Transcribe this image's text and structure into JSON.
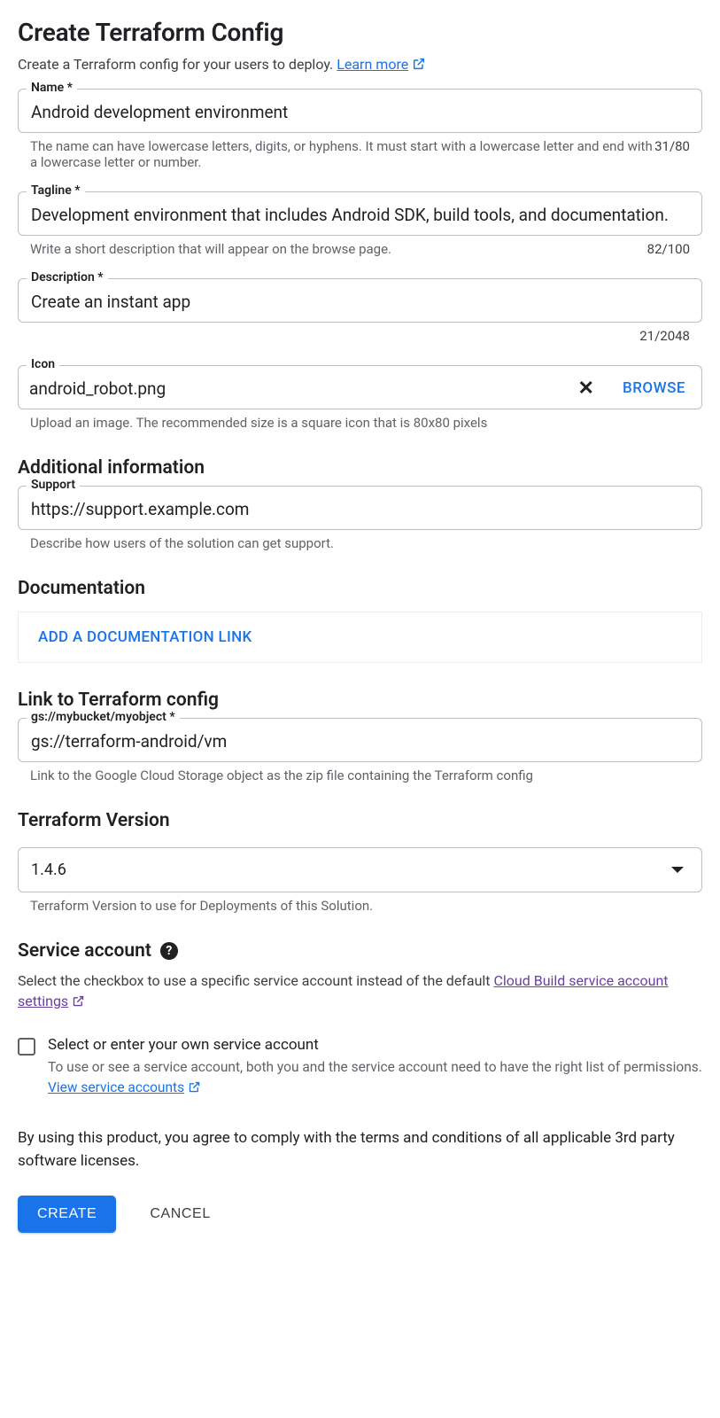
{
  "title": "Create Terraform Config",
  "subtitle_pre": "Create a Terraform config for your users to deploy. ",
  "subtitle_link": "Learn more",
  "fields": {
    "name": {
      "label": "Name *",
      "value": "Android development environment",
      "helper": "The name can have lowercase letters, digits, or hyphens. It must start with a lowercase letter and end with a lowercase letter or number.",
      "counter": "31/80"
    },
    "tagline": {
      "label": "Tagline *",
      "value": "Development environment that includes Android SDK, build tools, and documentation.",
      "helper": "Write a short description that will appear on the browse page.",
      "counter": "82/100"
    },
    "description": {
      "label": "Description *",
      "value": "Create an instant app",
      "counter": "21/2048"
    },
    "icon": {
      "label": "Icon",
      "value": "android_robot.png",
      "browse": "BROWSE",
      "helper": "Upload an image. The recommended size is a square icon that is 80x80 pixels"
    },
    "support": {
      "label": "Support",
      "value": "https://support.example.com",
      "helper": "Describe how users of the solution can get support."
    },
    "tflink": {
      "label": "gs://mybucket/myobject *",
      "value": "gs://terraform-android/vm",
      "helper": "Link to the Google Cloud Storage object as the zip file containing the Terraform config"
    },
    "tfversion": {
      "value": "1.4.6",
      "helper": "Terraform Version to use for Deployments of this Solution."
    }
  },
  "sections": {
    "additional": "Additional information",
    "documentation": "Documentation",
    "doc_button": "ADD A DOCUMENTATION LINK",
    "tflink": "Link to Terraform config",
    "tfversion": "Terraform Version",
    "svc": "Service account"
  },
  "service": {
    "desc_pre": "Select the checkbox to use a specific service account instead of the default ",
    "desc_link": "Cloud Build service account settings",
    "cb_label": "Select or enter your own service account",
    "cb_sub_pre": "To use or see a service account, both you and the service account need to have the right list of permissions. ",
    "cb_sub_link": "View service accounts"
  },
  "tos": "By using this product, you agree to comply with the terms and conditions of all applicable 3rd party software licenses.",
  "buttons": {
    "create": "CREATE",
    "cancel": "CANCEL"
  }
}
